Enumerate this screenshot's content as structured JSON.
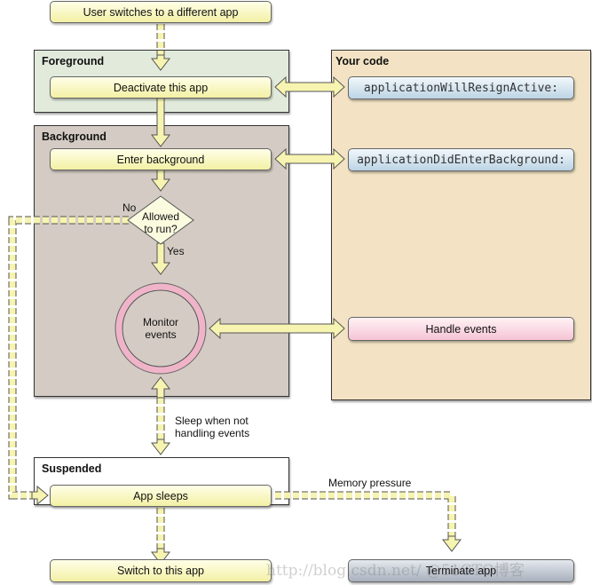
{
  "top": {
    "user_switches": "User switches to a different app"
  },
  "foreground": {
    "title": "Foreground",
    "deactivate": "Deactivate this app"
  },
  "background": {
    "title": "Background",
    "enter": "Enter background",
    "decision": "Allowed to run?",
    "no": "No",
    "yes": "Yes",
    "monitor": "Monitor events"
  },
  "your_code": {
    "title": "Your code",
    "will_resign": "applicationWillResignActive:",
    "did_enter_bg": "applicationDidEnterBackground:",
    "handle_events": "Handle events"
  },
  "sleep_label": "Sleep when not handling events",
  "suspended": {
    "title": "Suspended",
    "app_sleeps": "App sleeps"
  },
  "memory_pressure": "Memory pressure",
  "switch_to_app": "Switch to this app",
  "terminate_app": "Terminate app",
  "watermark": "http://blog.csdn.net/ @51CTO博客",
  "colors": {
    "foreground": "#e1eadb",
    "background": "#d4ccc4",
    "your_code": "#f3e3c4",
    "arrow": "#f6f4b0"
  }
}
